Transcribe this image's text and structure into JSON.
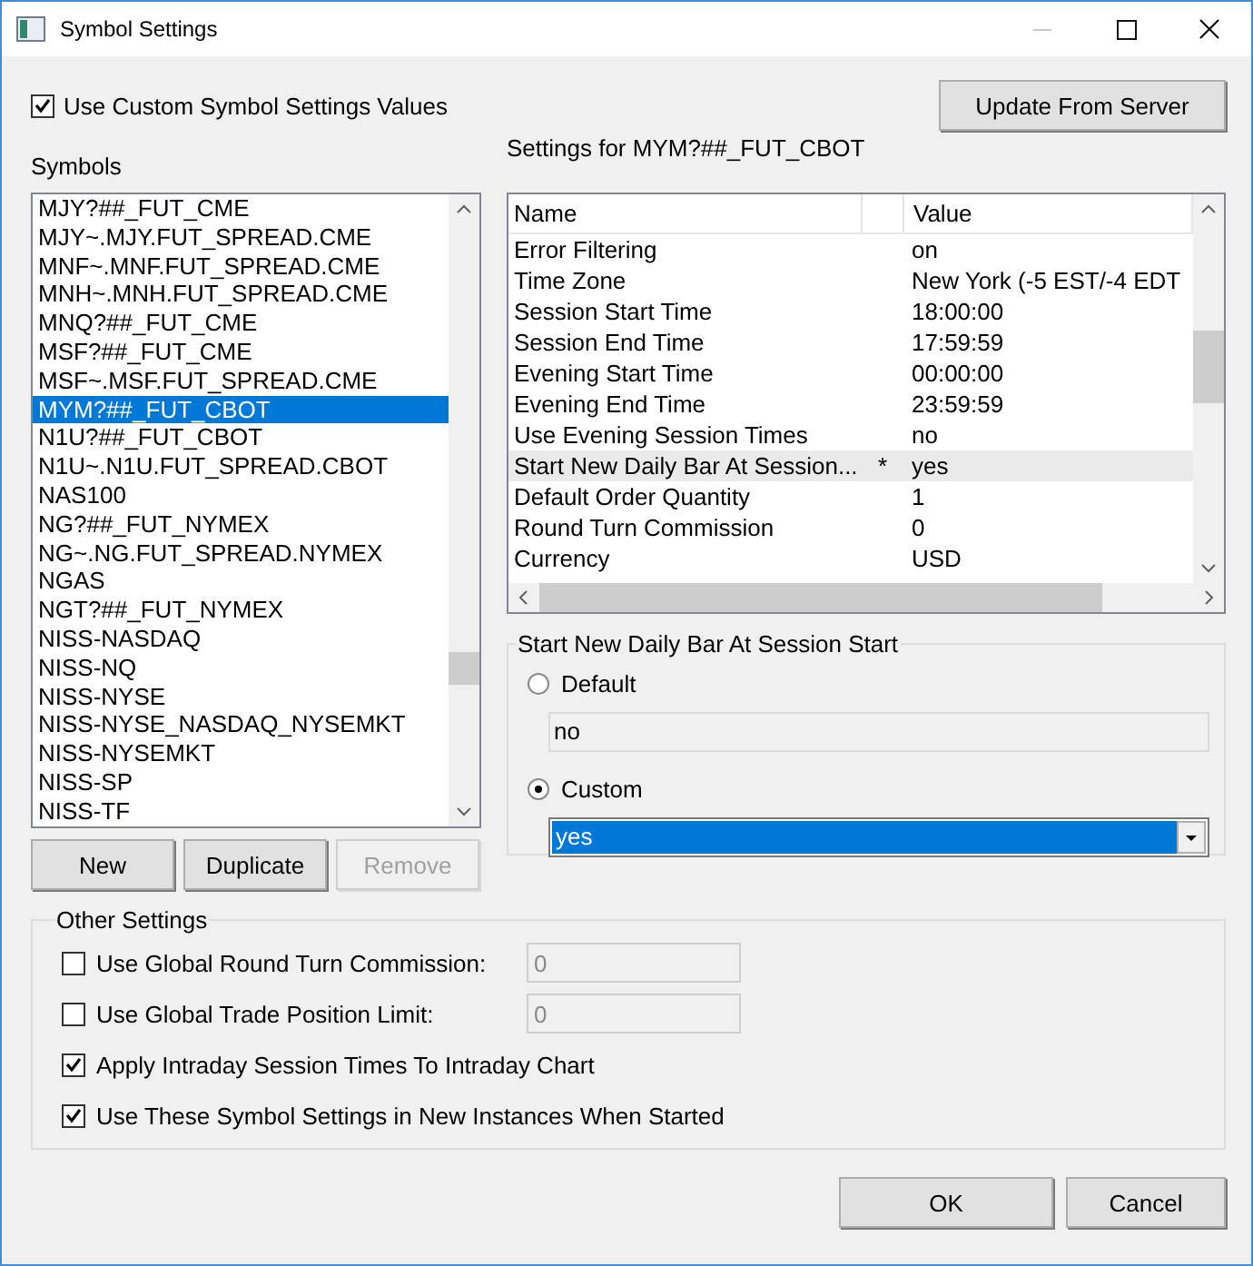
{
  "window": {
    "title": "Symbol Settings"
  },
  "use_custom": {
    "label": "Use Custom Symbol Settings Values",
    "checked": true
  },
  "update_button": "Update From Server",
  "symbols": {
    "label": "Symbols",
    "items": [
      {
        "name": "MJY?##_FUT_CME",
        "selected": false
      },
      {
        "name": "MJY~.MJY.FUT_SPREAD.CME",
        "selected": false
      },
      {
        "name": "MNF~.MNF.FUT_SPREAD.CME",
        "selected": false
      },
      {
        "name": "MNH~.MNH.FUT_SPREAD.CME",
        "selected": false
      },
      {
        "name": "MNQ?##_FUT_CME",
        "selected": false
      },
      {
        "name": "MSF?##_FUT_CME",
        "selected": false
      },
      {
        "name": "MSF~.MSF.FUT_SPREAD.CME",
        "selected": false
      },
      {
        "name": "MYM?##_FUT_CBOT",
        "selected": true
      },
      {
        "name": "N1U?##_FUT_CBOT",
        "selected": false
      },
      {
        "name": "N1U~.N1U.FUT_SPREAD.CBOT",
        "selected": false
      },
      {
        "name": "NAS100",
        "selected": false
      },
      {
        "name": "NG?##_FUT_NYMEX",
        "selected": false
      },
      {
        "name": "NG~.NG.FUT_SPREAD.NYMEX",
        "selected": false
      },
      {
        "name": "NGAS",
        "selected": false
      },
      {
        "name": "NGT?##_FUT_NYMEX",
        "selected": false
      },
      {
        "name": "NISS-NASDAQ",
        "selected": false
      },
      {
        "name": "NISS-NQ",
        "selected": false
      },
      {
        "name": "NISS-NYSE",
        "selected": false
      },
      {
        "name": "NISS-NYSE_NASDAQ_NYSEMKT",
        "selected": false
      },
      {
        "name": "NISS-NYSEMKT",
        "selected": false
      },
      {
        "name": "NISS-SP",
        "selected": false
      },
      {
        "name": "NISS-TF",
        "selected": false
      }
    ],
    "buttons": [
      {
        "label": "New",
        "disabled": false
      },
      {
        "label": "Duplicate",
        "disabled": false
      },
      {
        "label": "Remove",
        "disabled": true
      }
    ]
  },
  "settings": {
    "title": "Settings for MYM?##_FUT_CBOT",
    "columns": [
      "Name",
      "Value"
    ],
    "rows": [
      {
        "name": "Error Filtering",
        "value": "on",
        "selected": false
      },
      {
        "name": "Time Zone",
        "value": "New York (-5 EST/-4 EDT",
        "selected": false
      },
      {
        "name": "Session Start Time",
        "value": "18:00:00",
        "selected": false
      },
      {
        "name": "Session End Time",
        "value": "17:59:59",
        "selected": false
      },
      {
        "name": "Evening Start Time",
        "value": "00:00:00",
        "selected": false
      },
      {
        "name": "Evening End Time",
        "value": "23:59:59",
        "selected": false
      },
      {
        "name": "Use Evening Session Times",
        "value": "no",
        "selected": false
      },
      {
        "name": "Start New Daily Bar At Session...",
        "flag": "*",
        "value": "yes",
        "selected": true
      },
      {
        "name": "Default Order Quantity",
        "value": "1",
        "selected": false
      },
      {
        "name": "Round Turn Commission",
        "value": "0",
        "selected": false
      },
      {
        "name": "Currency",
        "value": "USD",
        "selected": false
      }
    ]
  },
  "detail": {
    "title": "Start New Daily Bar At Session Start",
    "options": [
      {
        "label": "Default",
        "selected": false,
        "field": {
          "kind": "text",
          "value": "no"
        }
      },
      {
        "label": "Custom",
        "selected": true,
        "field": {
          "kind": "dropdown",
          "value": "yes"
        }
      }
    ]
  },
  "other": {
    "title": "Other Settings",
    "items": [
      {
        "label": "Use Global Round Turn Commission:",
        "checked": false,
        "field": {
          "value": "0",
          "disabled": true
        }
      },
      {
        "label": "Use Global Trade Position Limit:",
        "checked": false,
        "field": {
          "value": "0",
          "disabled": true
        }
      },
      {
        "label": "Apply Intraday Session Times To Intraday Chart",
        "checked": true
      },
      {
        "label": "Use These Symbol Settings in New Instances When Started",
        "checked": true
      }
    ]
  },
  "buttons": [
    "OK",
    "Cancel"
  ]
}
